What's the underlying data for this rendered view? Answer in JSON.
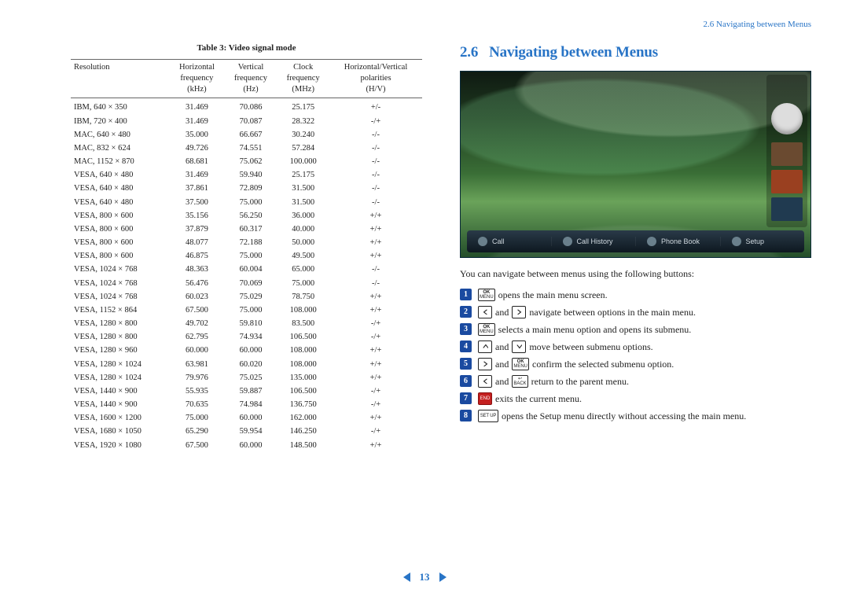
{
  "runningHeader": "2.6 Navigating between Menus",
  "table": {
    "caption": "Table 3:  Video signal mode",
    "headers": {
      "c0": "Resolution",
      "c1a": "Horizontal",
      "c1b": "frequency",
      "c1c": "(kHz)",
      "c2a": "Vertical",
      "c2b": "frequency",
      "c2c": "(Hz)",
      "c3a": "Clock",
      "c3b": "frequency",
      "c3c": "(MHz)",
      "c4a": "Horizontal/Vertical",
      "c4b": "polarities",
      "c4c": "(H/V)"
    },
    "rows": [
      {
        "res": "IBM, 640 × 350",
        "h": "31.469",
        "v": "70.086",
        "clk": "25.175",
        "pol": "+/-"
      },
      {
        "res": "IBM, 720 × 400",
        "h": "31.469",
        "v": "70.087",
        "clk": "28.322",
        "pol": "-/+"
      },
      {
        "res": "MAC, 640 × 480",
        "h": "35.000",
        "v": "66.667",
        "clk": "30.240",
        "pol": "-/-"
      },
      {
        "res": "MAC, 832 × 624",
        "h": "49.726",
        "v": "74.551",
        "clk": "57.284",
        "pol": "-/-"
      },
      {
        "res": "MAC, 1152 × 870",
        "h": "68.681",
        "v": "75.062",
        "clk": "100.000",
        "pol": "-/-"
      },
      {
        "res": "VESA, 640 × 480",
        "h": "31.469",
        "v": "59.940",
        "clk": "25.175",
        "pol": "-/-"
      },
      {
        "res": "VESA, 640 × 480",
        "h": "37.861",
        "v": "72.809",
        "clk": "31.500",
        "pol": "-/-"
      },
      {
        "res": "VESA, 640 × 480",
        "h": "37.500",
        "v": "75.000",
        "clk": "31.500",
        "pol": "-/-"
      },
      {
        "res": "VESA, 800 × 600",
        "h": "35.156",
        "v": "56.250",
        "clk": "36.000",
        "pol": "+/+"
      },
      {
        "res": "VESA, 800 × 600",
        "h": "37.879",
        "v": "60.317",
        "clk": "40.000",
        "pol": "+/+"
      },
      {
        "res": "VESA, 800 × 600",
        "h": "48.077",
        "v": "72.188",
        "clk": "50.000",
        "pol": "+/+"
      },
      {
        "res": "VESA, 800 × 600",
        "h": "46.875",
        "v": "75.000",
        "clk": "49.500",
        "pol": "+/+"
      },
      {
        "res": "VESA, 1024 × 768",
        "h": "48.363",
        "v": "60.004",
        "clk": "65.000",
        "pol": "-/-"
      },
      {
        "res": "VESA, 1024 × 768",
        "h": "56.476",
        "v": "70.069",
        "clk": "75.000",
        "pol": "-/-"
      },
      {
        "res": "VESA, 1024 × 768",
        "h": "60.023",
        "v": "75.029",
        "clk": "78.750",
        "pol": "+/+"
      },
      {
        "res": "VESA, 1152 × 864",
        "h": "67.500",
        "v": "75.000",
        "clk": "108.000",
        "pol": "+/+"
      },
      {
        "res": "VESA, 1280 × 800",
        "h": "49.702",
        "v": "59.810",
        "clk": "83.500",
        "pol": "-/+"
      },
      {
        "res": "VESA, 1280 × 800",
        "h": "62.795",
        "v": "74.934",
        "clk": "106.500",
        "pol": "-/+"
      },
      {
        "res": "VESA, 1280 × 960",
        "h": "60.000",
        "v": "60.000",
        "clk": "108.000",
        "pol": "+/+"
      },
      {
        "res": "VESA, 1280 × 1024",
        "h": "63.981",
        "v": "60.020",
        "clk": "108.000",
        "pol": "+/+"
      },
      {
        "res": "VESA, 1280 × 1024",
        "h": "79.976",
        "v": "75.025",
        "clk": "135.000",
        "pol": "+/+"
      },
      {
        "res": "VESA, 1440 × 900",
        "h": "55.935",
        "v": "59.887",
        "clk": "106.500",
        "pol": "-/+"
      },
      {
        "res": "VESA, 1440 × 900",
        "h": "70.635",
        "v": "74.984",
        "clk": "136.750",
        "pol": "-/+"
      },
      {
        "res": "VESA, 1600 × 1200",
        "h": "75.000",
        "v": "60.000",
        "clk": "162.000",
        "pol": "+/+"
      },
      {
        "res": "VESA, 1680 × 1050",
        "h": "65.290",
        "v": "59.954",
        "clk": "146.250",
        "pol": "-/+"
      },
      {
        "res": "VESA, 1920 × 1080",
        "h": "67.500",
        "v": "60.000",
        "clk": "148.500",
        "pol": "+/+"
      }
    ]
  },
  "section": {
    "number": "2.6",
    "title": "Navigating between Menus"
  },
  "screenshotMenu": {
    "items": [
      "Call",
      "Call History",
      "Phone Book",
      "Setup"
    ]
  },
  "intro": "You can navigate between menus using the following buttons:",
  "steps": [
    {
      "n": "1",
      "icons": [
        "ok"
      ],
      "text": " opens the main menu screen."
    },
    {
      "n": "2",
      "icons": [
        "left",
        "and",
        "right"
      ],
      "text": " navigate between options in the main menu."
    },
    {
      "n": "3",
      "icons": [
        "ok"
      ],
      "text": " selects a main menu option and opens its submenu."
    },
    {
      "n": "4",
      "icons": [
        "up",
        "and",
        "down"
      ],
      "text": " move between submenu options."
    },
    {
      "n": "5",
      "icons": [
        "right",
        "and",
        "ok"
      ],
      "text": " confirm the selected submenu option."
    },
    {
      "n": "6",
      "icons": [
        "left",
        "and",
        "back"
      ],
      "text": " return to the parent menu."
    },
    {
      "n": "7",
      "icons": [
        "end"
      ],
      "text": " exits the current menu."
    },
    {
      "n": "8",
      "icons": [
        "setup"
      ],
      "text": " opens the Setup menu directly without accessing the main menu."
    }
  ],
  "buttonLabels": {
    "ok": "OK\nMENU",
    "back": "←\nBACK",
    "end": "END",
    "setup": "SET UP",
    "and": "and"
  },
  "pageNumber": "13"
}
